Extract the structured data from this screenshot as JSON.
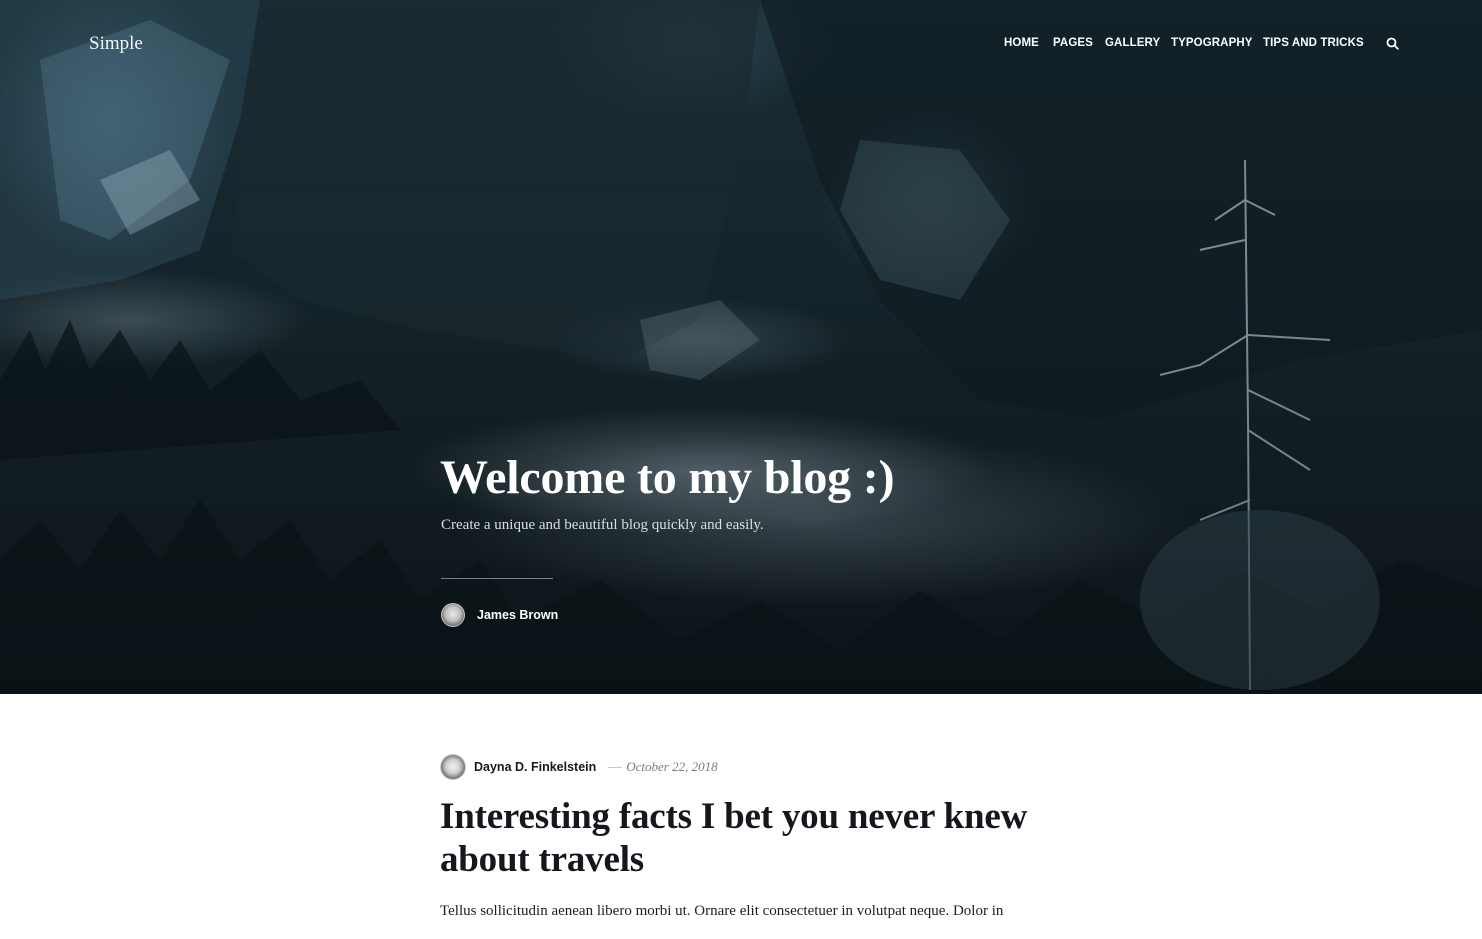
{
  "header": {
    "site_title": "Simple",
    "nav": [
      {
        "label": "HOME"
      },
      {
        "label": "PAGES"
      },
      {
        "label": "GALLERY"
      },
      {
        "label": "TYPOGRAPHY"
      },
      {
        "label": "TIPS AND TRICKS"
      }
    ],
    "search_icon": "search-icon"
  },
  "hero": {
    "title": "Welcome to my blog :)",
    "subtitle": "Create a unique and beautiful blog quickly and easily.",
    "author": "James Brown",
    "image": "misty-snowy-mountain-forest"
  },
  "post": {
    "author": "Dayna D. Finkelstein",
    "date": "October 22, 2018",
    "title": "Interesting facts I bet you never knew about travels",
    "excerpt": "Tellus sollicitudin aenean libero morbi ut. Ornare elit consectetuer in volutpat neque. Dolor in"
  },
  "colors": {
    "hero_dark": "#132127",
    "text_dark": "#15171c",
    "meta_gray": "#7a7a7a"
  }
}
